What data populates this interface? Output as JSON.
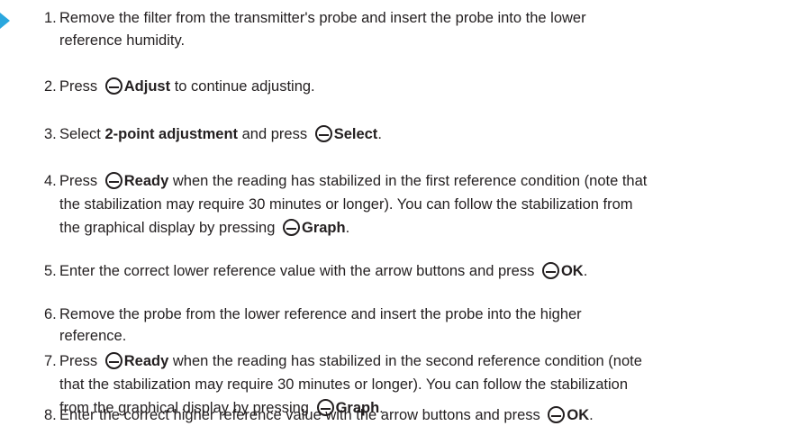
{
  "steps": [
    {
      "num": "1.",
      "lines": [
        [
          "Remove the filter from the transmitter's probe and insert the probe into the lower"
        ],
        [
          "reference humidity."
        ]
      ]
    },
    {
      "num": "2.",
      "lines": [
        [
          "Press ",
          {
            "btn": true
          },
          {
            "b": "Adjust"
          },
          " to continue adjusting."
        ]
      ]
    },
    {
      "num": "3.",
      "lines": [
        [
          "Select ",
          {
            "b": "2-point adjustment"
          },
          " and press ",
          {
            "btn": true
          },
          {
            "b": "Select"
          },
          "."
        ]
      ]
    },
    {
      "num": "4.",
      "lines": [
        [
          "Press ",
          {
            "btn": true
          },
          {
            "b": "Ready"
          },
          " when the reading has stabilized in the first reference condition (note that"
        ],
        [
          "the stabilization may require 30 minutes or longer). You can follow the stabilization from"
        ],
        [
          "the graphical display by pressing ",
          {
            "btn": true
          },
          {
            "b": "Graph"
          },
          "."
        ]
      ]
    },
    {
      "num": "5.",
      "lines": [
        [
          "Enter the correct lower reference value with the arrow buttons and press ",
          {
            "btn": true
          },
          {
            "b": "OK"
          },
          "."
        ]
      ]
    },
    {
      "num": "6.",
      "lines": [
        [
          "Remove the probe from the lower reference and insert the probe into the higher"
        ],
        [
          "reference."
        ]
      ]
    },
    {
      "num": "7.",
      "lines": [
        [
          "Press ",
          {
            "btn": true
          },
          {
            "b": "Ready"
          },
          " when the reading has stabilized in the second reference condition (note"
        ],
        [
          "that the stabilization may require 30 minutes or longer). You can follow the stabilization"
        ],
        [
          "from the graphical display by pressing ",
          {
            "btn": true
          },
          {
            "b": "Graph"
          },
          "."
        ]
      ]
    },
    {
      "num": "8.",
      "lines": [
        [
          "Enter the correct higher reference value with the arrow buttons and press ",
          {
            "btn": true
          },
          {
            "b": "OK"
          },
          "."
        ]
      ]
    }
  ]
}
